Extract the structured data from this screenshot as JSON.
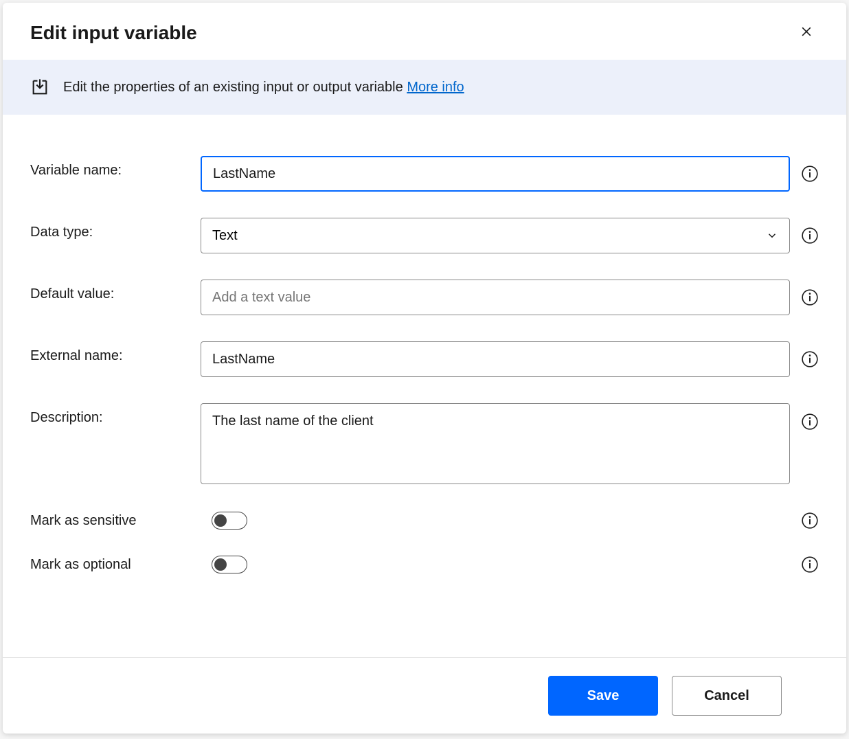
{
  "header": {
    "title": "Edit input variable"
  },
  "banner": {
    "text": "Edit the properties of an existing input or output variable ",
    "link_text": "More info"
  },
  "form": {
    "variable_name": {
      "label": "Variable name:",
      "value": "LastName"
    },
    "data_type": {
      "label": "Data type:",
      "value": "Text"
    },
    "default_value": {
      "label": "Default value:",
      "value": "",
      "placeholder": "Add a text value"
    },
    "external_name": {
      "label": "External name:",
      "value": "LastName"
    },
    "description": {
      "label": "Description:",
      "value": "The last name of the client"
    },
    "mark_sensitive": {
      "label": "Mark as sensitive",
      "value": false
    },
    "mark_optional": {
      "label": "Mark as optional",
      "value": false
    }
  },
  "footer": {
    "save_label": "Save",
    "cancel_label": "Cancel"
  }
}
